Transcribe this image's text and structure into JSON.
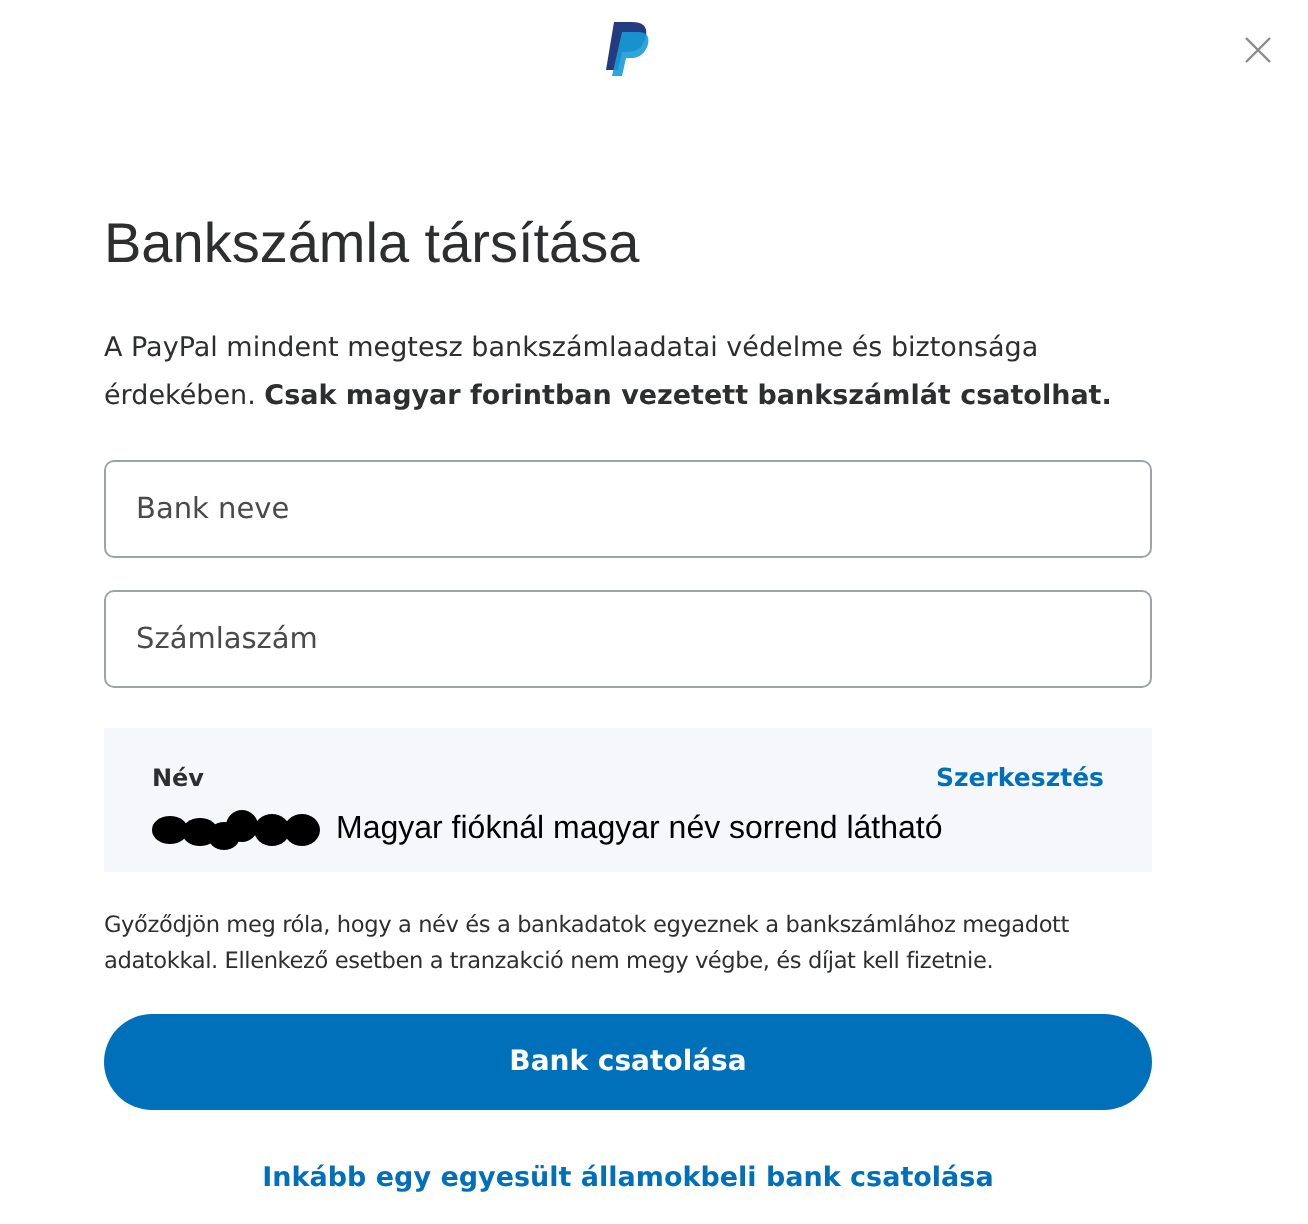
{
  "title": "Bankszámla társítása",
  "intro": "A PayPal mindent megtesz bankszámlaadatai védelme és biztonsága érdekében. **Csak magyar forintban vezetett bankszámlát csatolhat.**",
  "fields": [
    {
      "placeholder": "Bank neve"
    },
    {
      "placeholder": "Számlaszám"
    }
  ],
  "name_card": {
    "label": "Név",
    "edit_link": "Szerkesztés",
    "note": "Magyar fióknál magyar név sorrend látható"
  },
  "notice": "Győződjön meg róla, hogy a név és a bankadatok egyeznek a bankszámlához megadott adatokkal. Ellenkező esetben a tranzakció nem megy végbe, és díjat kell fizetnie.",
  "primary_button": "Bank csatolása",
  "alt_link": "Inkább egy egyesült államokbeli bank csatolása"
}
